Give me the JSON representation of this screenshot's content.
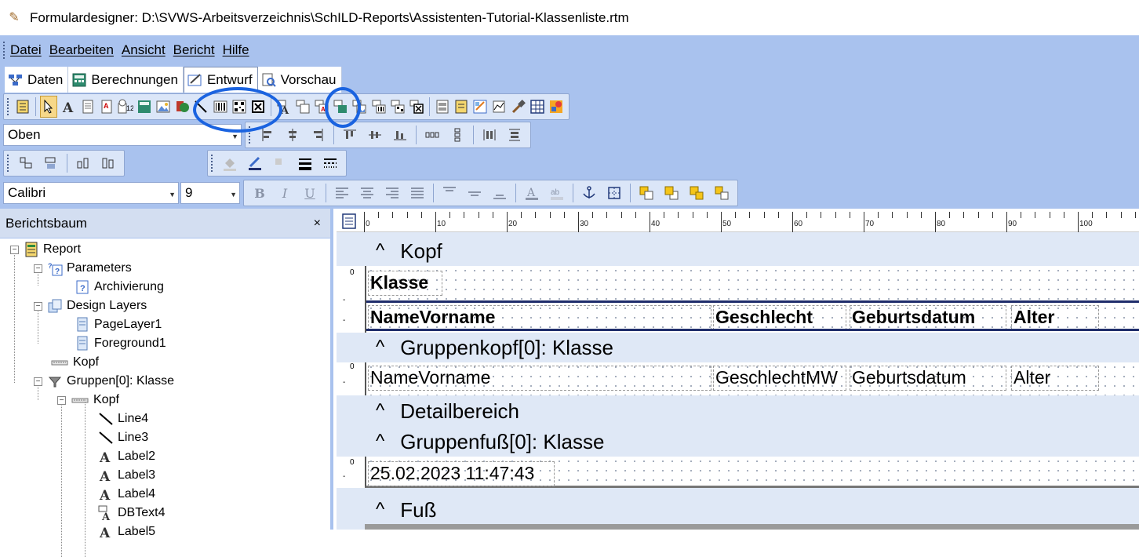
{
  "window": {
    "title": "Formulardesigner: D:\\SVWS-Arbeitsverzeichnis\\SchILD-Reports\\Assistenten-Tutorial-Klassenliste.rtm"
  },
  "menu": {
    "items": [
      "Datei",
      "Bearbeiten",
      "Ansicht",
      "Bericht",
      "Hilfe"
    ]
  },
  "tabs": [
    {
      "label": "Daten",
      "icon": "data-icon"
    },
    {
      "label": "Berechnungen",
      "icon": "calculator-icon"
    },
    {
      "label": "Entwurf",
      "icon": "design-icon",
      "active": true
    },
    {
      "label": "Vorschau",
      "icon": "preview-icon"
    }
  ],
  "toolbar": {
    "position_combo": "Oben",
    "font_combo": "Calibri",
    "size_combo": "9"
  },
  "tree": {
    "title": "Berichtsbaum",
    "close": "×",
    "nodes": [
      {
        "label": "Report",
        "icon": "report-icon"
      },
      {
        "label": "Parameters",
        "icon": "parameters-icon"
      },
      {
        "label": "Archivierung",
        "icon": "parameter-icon"
      },
      {
        "label": "Design Layers",
        "icon": "layers-icon"
      },
      {
        "label": "PageLayer1",
        "icon": "page-icon"
      },
      {
        "label": "Foreground1",
        "icon": "page-icon"
      },
      {
        "label": "Kopf",
        "icon": "band-icon"
      },
      {
        "label": "Gruppen[0]: Klasse",
        "icon": "group-icon"
      },
      {
        "label": "Kopf",
        "icon": "band-icon"
      },
      {
        "label": "Line4",
        "icon": "line-icon"
      },
      {
        "label": "Line3",
        "icon": "line-icon"
      },
      {
        "label": "Label2",
        "icon": "label-icon"
      },
      {
        "label": "Label3",
        "icon": "label-icon"
      },
      {
        "label": "Label4",
        "icon": "label-icon"
      },
      {
        "label": "DBText4",
        "icon": "dbtext-icon"
      },
      {
        "label": "Label5",
        "icon": "label-icon"
      }
    ]
  },
  "designer": {
    "ruler_labels": [
      "0",
      "10",
      "20",
      "30",
      "40",
      "50",
      "60",
      "70",
      "80",
      "90",
      "100"
    ],
    "vruler_zero": "0",
    "bands": {
      "kopf": "Kopf",
      "gruppenkopf": "Gruppenkopf[0]: Klasse",
      "detail": "Detailbereich",
      "gruppenfuss": "Gruppenfuß[0]: Klasse",
      "fuss": "Fuß"
    },
    "kopf_components": {
      "klasse": "Klasse",
      "namevorname": "NameVorname",
      "geschlecht": "Geschlecht",
      "geburtsdatum": "Geburtsdatum",
      "alter": "Alter"
    },
    "group_components": {
      "namevorname": "NameVorname",
      "geschlecht": "GeschlechtMW",
      "geburtsdatum": "Geburtsdatum",
      "alter": "Alter"
    },
    "footer_components": {
      "timestamp": "25.02.2023 11:47:43"
    }
  },
  "colors": {
    "chrome": "#a9c2ee",
    "highlight": "#1a63e0"
  }
}
